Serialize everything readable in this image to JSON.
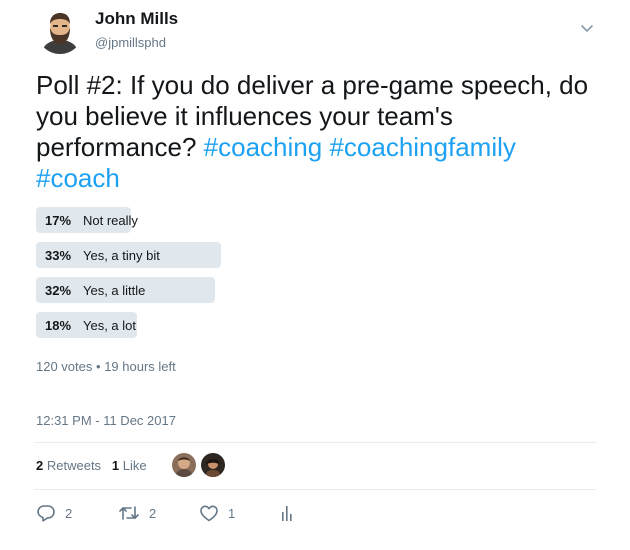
{
  "author": {
    "name": "John Mills",
    "handle": "@jpmillsphd"
  },
  "tweet": {
    "text": "Poll #2: If you do deliver a pre-game speech, do you believe it influences your team's performance?",
    "hashtags": [
      "#coaching",
      "#coachingfamily",
      "#coach"
    ]
  },
  "poll": {
    "options": [
      {
        "percent": 17,
        "percent_label": "17%",
        "label": "Not really"
      },
      {
        "percent": 33,
        "percent_label": "33%",
        "label": "Yes, a tiny bit"
      },
      {
        "percent": 32,
        "percent_label": "32%",
        "label": "Yes, a little"
      },
      {
        "percent": 18,
        "percent_label": "18%",
        "label": "Yes, a lot"
      }
    ],
    "votes": "120 votes",
    "separator": "•",
    "time_left": "19 hours left"
  },
  "timestamp": "12:31 PM - 11 Dec 2017",
  "stats": {
    "retweets_count": "2",
    "retweets_label": "Retweets",
    "likes_count": "1",
    "likes_label": "Like"
  },
  "actions": {
    "reply_count": "2",
    "retweet_count": "2",
    "like_count": "1"
  },
  "colors": {
    "accent": "#1da1f2",
    "poll_bar": "#e1e8ed",
    "secondary_text": "#657786"
  }
}
